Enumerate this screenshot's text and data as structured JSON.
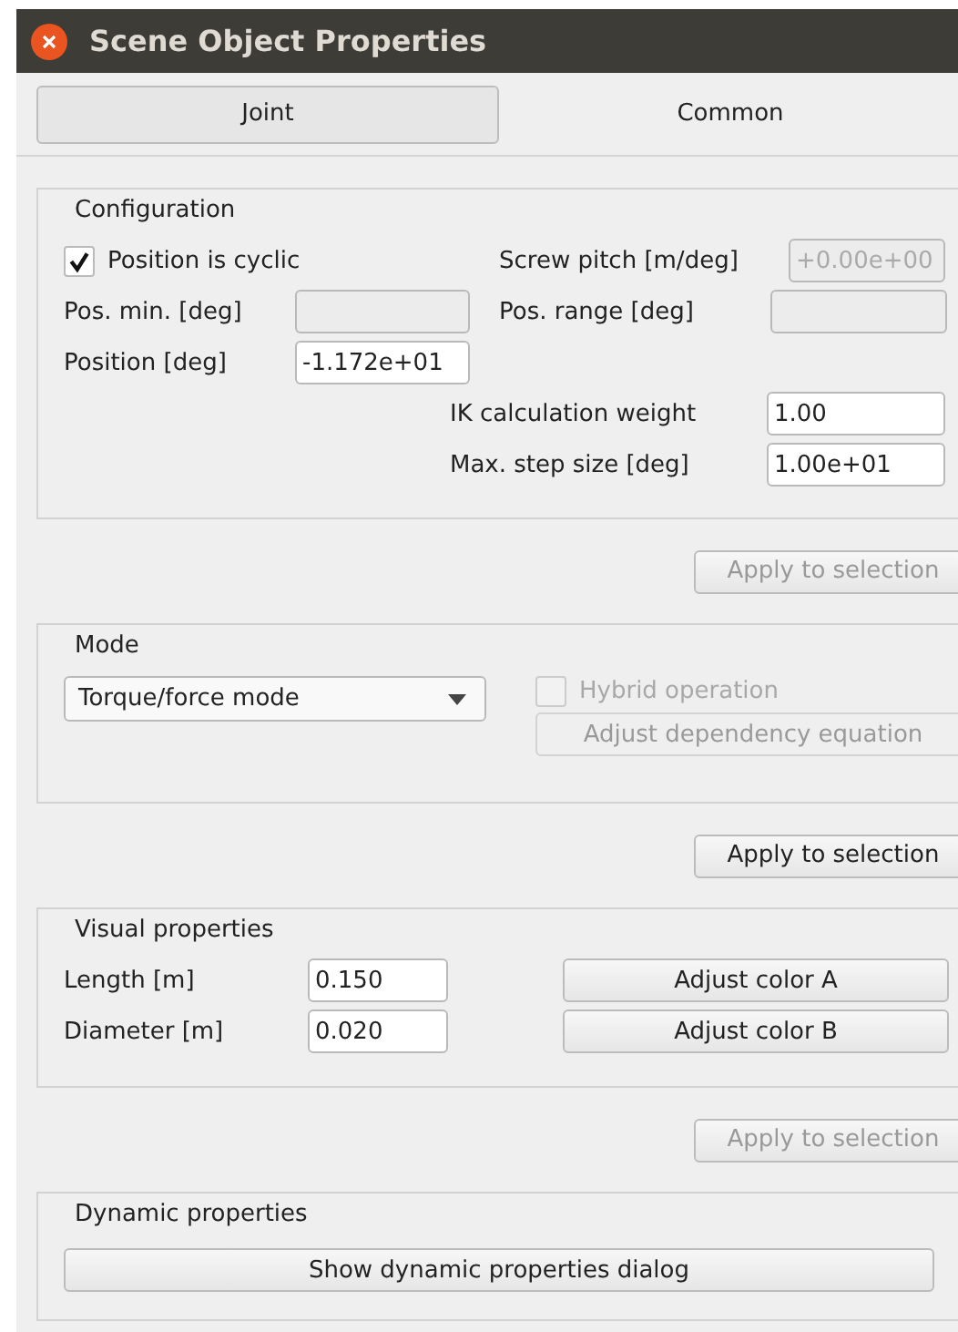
{
  "window": {
    "title": "Scene Object Properties"
  },
  "tabs": [
    {
      "label": "Joint",
      "selected": true
    },
    {
      "label": "Common",
      "selected": false
    }
  ],
  "configuration": {
    "title": "Configuration",
    "cyclic": {
      "label": "Position is cyclic",
      "checked": true
    },
    "screw_pitch": {
      "label": "Screw pitch [m/deg]",
      "value": "+0.00e+00",
      "disabled": true
    },
    "pos_min": {
      "label": "Pos. min. [deg]",
      "disabled": true
    },
    "pos_range": {
      "label": "Pos. range [deg]",
      "disabled": true
    },
    "position": {
      "label": "Position [deg]",
      "value": "-1.172e+01",
      "disabled": false
    },
    "ik_weight": {
      "label": "IK calculation weight",
      "value": "1.00",
      "disabled": false
    },
    "max_step": {
      "label": "Max. step size [deg]",
      "value": "1.00e+01",
      "disabled": false
    },
    "apply": {
      "label": "Apply to selection",
      "disabled": true
    }
  },
  "mode": {
    "title": "Mode",
    "dropdown": {
      "value": "Torque/force mode"
    },
    "hybrid": {
      "label": "Hybrid operation",
      "checked": false,
      "disabled": true
    },
    "dependency": {
      "label": "Adjust dependency equation",
      "disabled": true
    },
    "apply": {
      "label": "Apply to selection",
      "disabled": false
    }
  },
  "visual": {
    "title": "Visual properties",
    "length": {
      "label": "Length [m]",
      "value": "0.150"
    },
    "diameter": {
      "label": "Diameter [m]",
      "value": "0.020"
    },
    "color_a": {
      "label": "Adjust color A"
    },
    "color_b": {
      "label": "Adjust color B"
    },
    "apply": {
      "label": "Apply to selection",
      "disabled": true
    }
  },
  "dynamic": {
    "title": "Dynamic properties",
    "button": {
      "label": "Show dynamic properties dialog"
    }
  }
}
